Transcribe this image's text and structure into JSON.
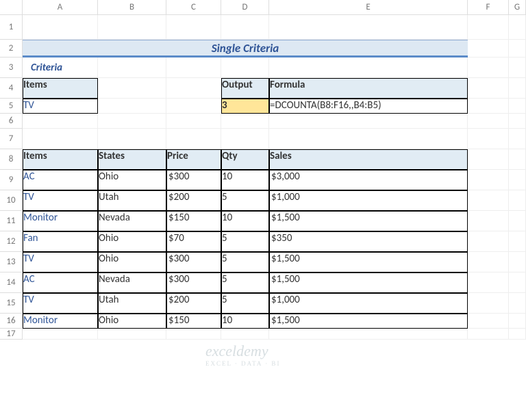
{
  "columns": [
    "A",
    "B",
    "C",
    "D",
    "E",
    "F",
    "G"
  ],
  "rows": [
    "1",
    "2",
    "3",
    "4",
    "5",
    "6",
    "7",
    "8",
    "9",
    "10",
    "11",
    "12",
    "13",
    "14",
    "15",
    "16",
    "17"
  ],
  "title": "Single Criteria",
  "criteria_label": "Criteria",
  "criteria_header": "Items",
  "criteria_value": "TV",
  "output_header": "Output",
  "output_value": "3",
  "formula_header": "Formula",
  "formula_value": "=DCOUNTA(B8:F16,,B4:B5)",
  "table_headers": {
    "items": "Items",
    "states": "States",
    "price": "Price",
    "qty": "Qty",
    "sales": "Sales"
  },
  "currency": "$",
  "data_rows": [
    {
      "item": "AC",
      "state": "Ohio",
      "price": "300",
      "qty": "10",
      "sales": "3,000"
    },
    {
      "item": "TV",
      "state": "Utah",
      "price": "200",
      "qty": "5",
      "sales": "1,000"
    },
    {
      "item": "Monitor",
      "state": "Nevada",
      "price": "150",
      "qty": "10",
      "sales": "1,500"
    },
    {
      "item": "Fan",
      "state": "Ohio",
      "price": "70",
      "qty": "5",
      "sales": "350"
    },
    {
      "item": "TV",
      "state": "Ohio",
      "price": "300",
      "qty": "5",
      "sales": "1,500"
    },
    {
      "item": "AC",
      "state": "Nevada",
      "price": "300",
      "qty": "5",
      "sales": "1,500"
    },
    {
      "item": "TV",
      "state": "Utah",
      "price": "200",
      "qty": "5",
      "sales": "1,000"
    },
    {
      "item": "Monitor",
      "state": "Ohio",
      "price": "150",
      "qty": "10",
      "sales": "1,500"
    }
  ],
  "watermark": {
    "main": "exceldemy",
    "sub": "EXCEL · DATA · BI"
  }
}
